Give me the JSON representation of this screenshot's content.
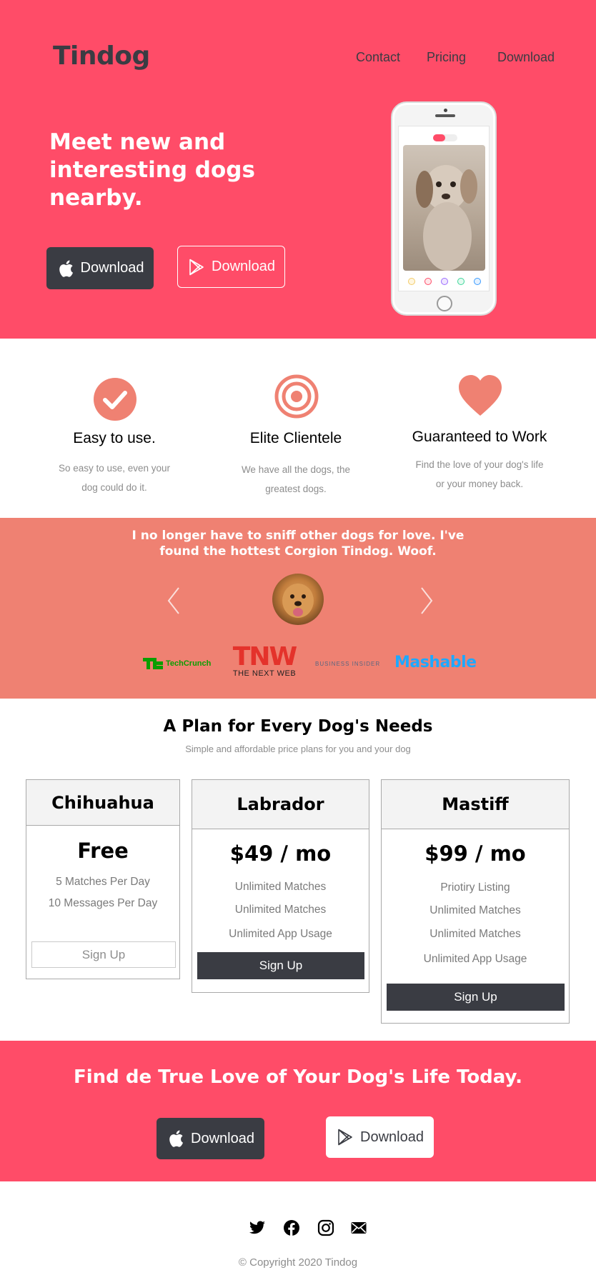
{
  "colors": {
    "hero_bg": "#ff4c68",
    "testimonial_bg": "#ef8172",
    "dark": "#3a3c43",
    "accent": "#ef8172",
    "muted_text": "#8d8d8d"
  },
  "header": {
    "brand": "Tindog",
    "nav": [
      "Contact",
      "Pricing",
      "Download"
    ]
  },
  "hero": {
    "title": "Meet new and interesting dogs nearby.",
    "apple_button": {
      "label": "Download",
      "icon": "apple-icon"
    },
    "google_button": {
      "label": "Download",
      "icon": "google-play-icon"
    }
  },
  "features": [
    {
      "icon": "check-circle-icon",
      "title": "Easy to use.",
      "text": "So easy to use, even your dog could do it."
    },
    {
      "icon": "bullseye-icon",
      "title": "Elite Clientele",
      "text": "We have all the dogs, the greatest dogs."
    },
    {
      "icon": "heart-icon",
      "title": "Guaranteed to Work",
      "text": "Find the love of your dog's life or your money back."
    }
  ],
  "testimonial": {
    "quote": "I no longer have to sniff other dogs for love. I've found the hottest Corgion Tindog. Woof."
  },
  "press": {
    "techcrunch": "TechCrunch",
    "tnw_mark": "TNW",
    "tnw_name": "THE NEXT WEB",
    "business_insider": "BUSINESS INSIDER",
    "mashable": "Mashable"
  },
  "pricing": {
    "title": "A Plan for Every Dog's Needs",
    "subtitle": "Simple and affordable price plans for you and your dog",
    "plans": [
      {
        "name": "Chihuahua",
        "price": "Free",
        "features": [
          "5 Matches Per Day",
          "10 Messages Per Day"
        ],
        "button": "Sign Up"
      },
      {
        "name": "Labrador",
        "price": "$49 / mo",
        "features": [
          "Unlimited Matches",
          "Unlimited Matches",
          "Unlimited App Usage"
        ],
        "button": "Sign Up"
      },
      {
        "name": "Mastiff",
        "price": "$99 / mo",
        "features": [
          "Priotiry Listing",
          "Unlimited Matches",
          "Unlimited Matches",
          "Unlimited App Usage"
        ],
        "button": "Sign Up"
      }
    ]
  },
  "cta": {
    "title": "Find de True Love of Your Dog's Life Today.",
    "apple_button": {
      "label": "Download",
      "icon": "apple-icon"
    },
    "google_button": {
      "label": "Download",
      "icon": "google-play-icon"
    }
  },
  "footer": {
    "social_icons": [
      "twitter-icon",
      "facebook-icon",
      "instagram-icon",
      "envelope-icon"
    ],
    "copyright": "© Copyright 2020 Tindog"
  }
}
